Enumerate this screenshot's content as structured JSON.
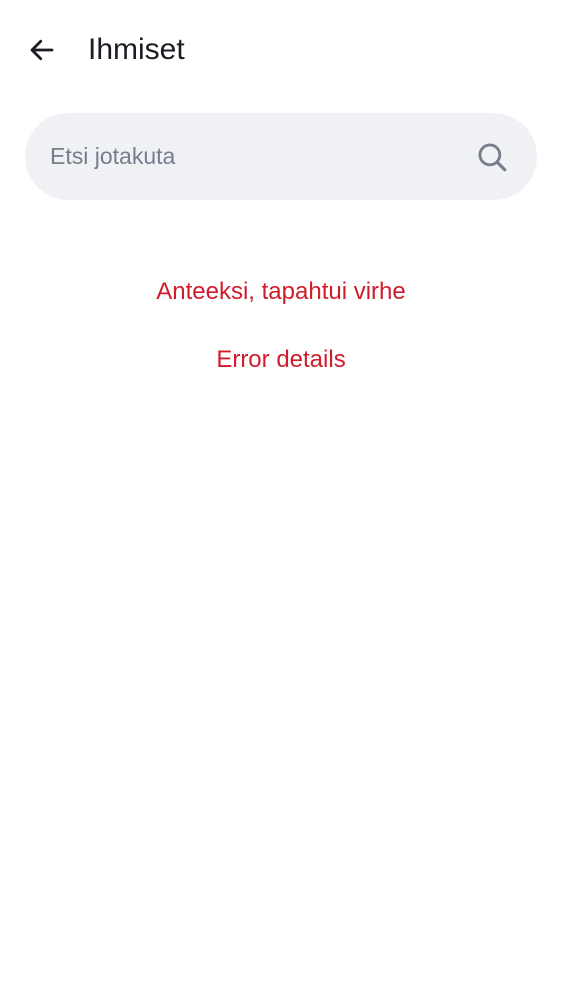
{
  "header": {
    "back_icon": "arrow-left-icon",
    "title": "Ihmiset"
  },
  "search": {
    "placeholder": "Etsi jotakuta",
    "value": "",
    "icon": "search-icon"
  },
  "error": {
    "message": "Anteeksi, tapahtui virhe",
    "details_link": "Error details"
  },
  "colors": {
    "text_primary": "#1b1d24",
    "placeholder": "#767e8c",
    "search_background": "#eff1f5",
    "error": "#d01c2b"
  }
}
